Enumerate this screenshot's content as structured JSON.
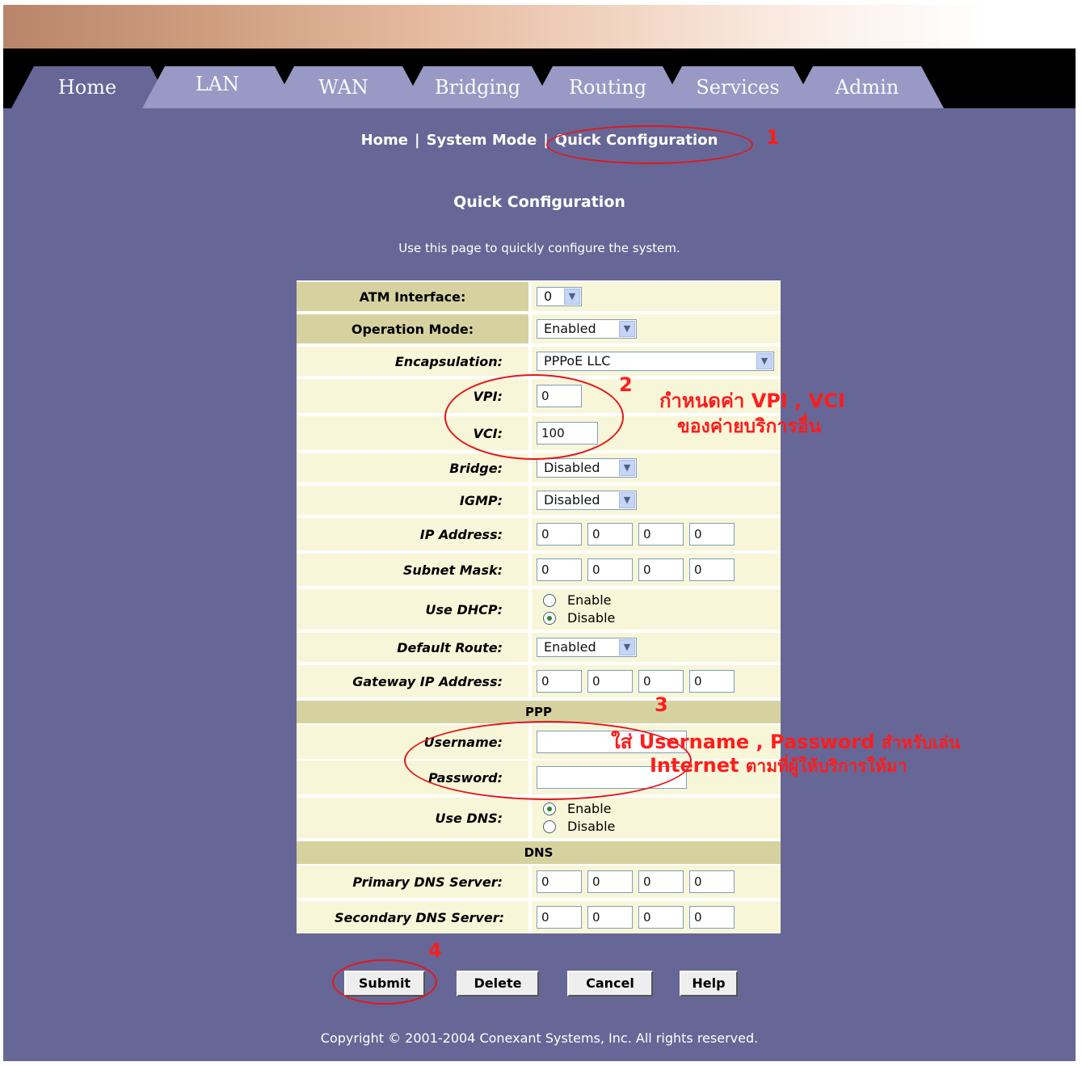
{
  "tabs": [
    "Home",
    "LAN",
    "WAN",
    "Bridging",
    "Routing",
    "Services",
    "Admin"
  ],
  "subnav": {
    "home": "Home",
    "system_mode": "System Mode",
    "quick_config": "Quick Configuration",
    "separator": "|"
  },
  "page": {
    "title": "Quick Configuration",
    "description": "Use this page to quickly configure the system."
  },
  "form": {
    "atm_interface": {
      "label": "ATM Interface:",
      "value": "0"
    },
    "operation_mode": {
      "label": "Operation Mode:",
      "value": "Enabled"
    },
    "encapsulation": {
      "label": "Encapsulation:",
      "value": "PPPoE LLC"
    },
    "vpi": {
      "label": "VPI:",
      "value": "0"
    },
    "vci": {
      "label": "VCI:",
      "value": "100"
    },
    "bridge": {
      "label": "Bridge:",
      "value": "Disabled"
    },
    "igmp": {
      "label": "IGMP:",
      "value": "Disabled"
    },
    "ip_address": {
      "label": "IP Address:",
      "values": [
        "0",
        "0",
        "0",
        "0"
      ]
    },
    "subnet_mask": {
      "label": "Subnet Mask:",
      "values": [
        "0",
        "0",
        "0",
        "0"
      ]
    },
    "use_dhcp": {
      "label": "Use DHCP:",
      "options": [
        "Enable",
        "Disable"
      ],
      "selected": "Disable"
    },
    "default_route": {
      "label": "Default Route:",
      "value": "Enabled"
    },
    "gateway_ip": {
      "label": "Gateway IP Address:",
      "values": [
        "0",
        "0",
        "0",
        "0"
      ]
    },
    "ppp_header": "PPP",
    "username": {
      "label": "Username:",
      "value": ""
    },
    "password": {
      "label": "Password:",
      "value": ""
    },
    "use_dns": {
      "label": "Use DNS:",
      "options": [
        "Enable",
        "Disable"
      ],
      "selected": "Enable"
    },
    "dns_header": "DNS",
    "primary_dns": {
      "label": "Primary DNS Server:",
      "values": [
        "0",
        "0",
        "0",
        "0"
      ]
    },
    "secondary_dns": {
      "label": "Secondary DNS Server:",
      "values": [
        "0",
        "0",
        "0",
        "0"
      ]
    }
  },
  "buttons": {
    "submit": "Submit",
    "delete": "Delete",
    "cancel": "Cancel",
    "help": "Help"
  },
  "copyright": "Copyright © 2001-2004 Conexant Systems, Inc. All rights reserved.",
  "annotations": {
    "step1": "1",
    "step2": "2",
    "step2_line1_thai": "กำหนดค่า",
    "step2_line1_en": "VPI , VCI",
    "step2_line2": "ของค่ายบริการอื่น",
    "step3": "3",
    "step3_line1_thai_a": "ใส่",
    "step3_line1_en": "Username , Password",
    "step3_line1_thai_b": "สำหรับเล่น",
    "step3_line2_en": "Internet",
    "step3_line2_thai": "ตามที่ผู้ให้บริการให้มา",
    "step4": "4"
  },
  "colors": {
    "background": "#666796",
    "tab": "#9899c4",
    "row": "#f8f6d8",
    "header_row": "#d6d2a0",
    "annotation": "#ff1c1c"
  }
}
